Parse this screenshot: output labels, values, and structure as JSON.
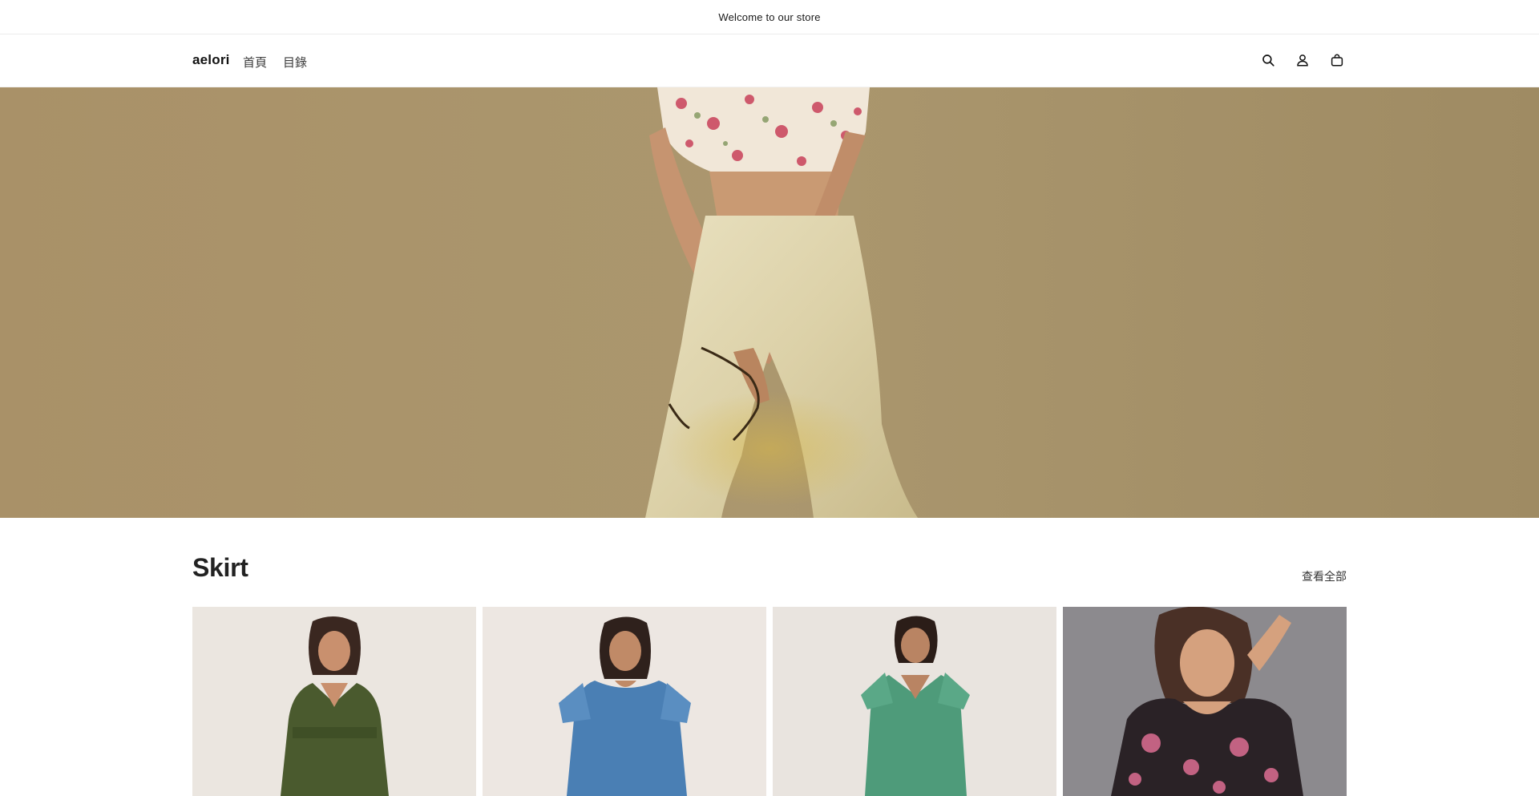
{
  "announcement": {
    "text": "Welcome to our store"
  },
  "header": {
    "logo": "aelori",
    "nav": [
      {
        "label": "首頁"
      },
      {
        "label": "目錄"
      }
    ],
    "icons": [
      "search-icon",
      "account-icon",
      "cart-icon"
    ]
  },
  "hero": {
    "image": "woman-in-floral-top-and-cream-trousers"
  },
  "collection": {
    "title": "Skirt",
    "view_all": "查看全部",
    "products": [
      {
        "image": "green-v-neck-dress",
        "color": "#4a5a2e"
      },
      {
        "image": "blue-denim-dress",
        "color": "#4a7fb4"
      },
      {
        "image": "green-lace-tulle-dress",
        "color": "#4e9b7a"
      },
      {
        "image": "black-floral-cold-shoulder-dress",
        "color": "#2a2226"
      }
    ]
  },
  "colors": {
    "hero_bg": "#a8926a",
    "text": "#121212"
  }
}
